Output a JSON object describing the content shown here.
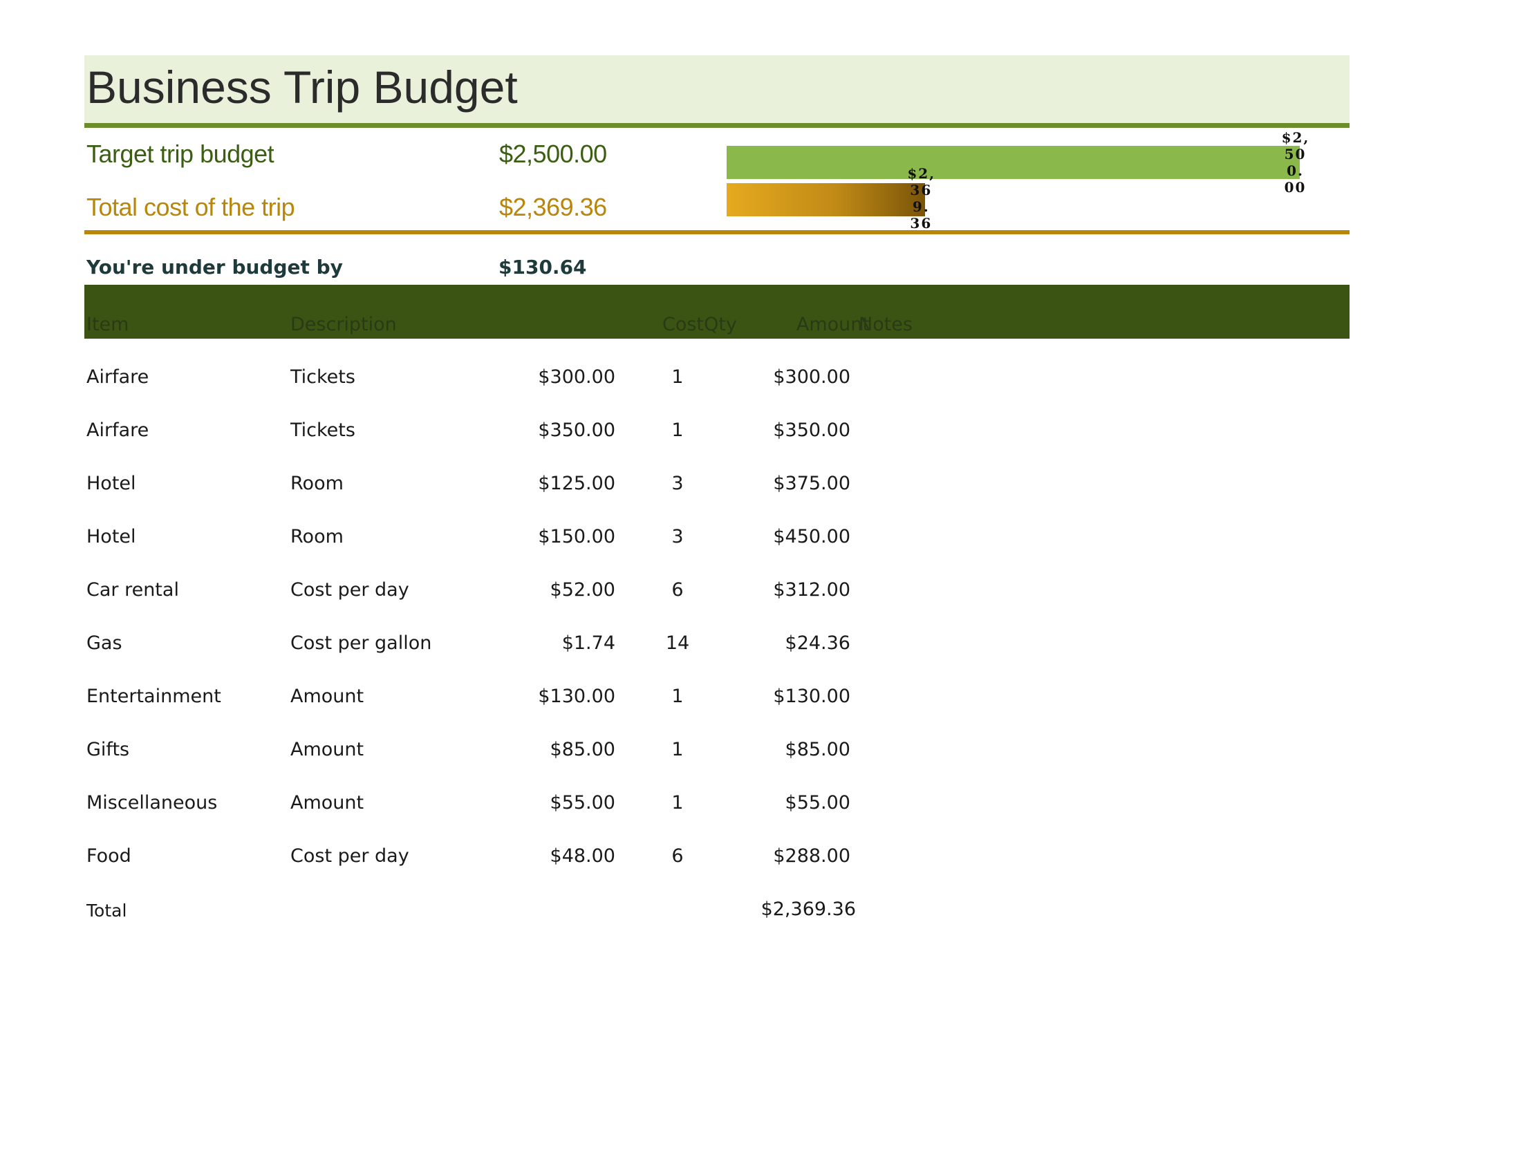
{
  "title": "Business Trip Budget",
  "summary": {
    "target_label": "Target trip budget",
    "target_value": "$2,500.00",
    "total_label": "Total cost of the trip",
    "total_value": "$2,369.36",
    "under_label": "You're under budget by",
    "under_value": "$130.64"
  },
  "chart_data": {
    "type": "bar",
    "orientation": "horizontal",
    "categories": [
      "Target trip budget",
      "Total cost of the trip"
    ],
    "values": [
      2500.0,
      2369.36
    ],
    "labels": [
      "$2,500.00",
      "$2,369.36"
    ],
    "xlim": [
      2300,
      2510
    ],
    "colors": [
      "#8bb84b",
      "#c08a16"
    ],
    "title": "",
    "xlabel": "",
    "ylabel": ""
  },
  "table": {
    "headers": {
      "item": "Item",
      "description": "Description",
      "cost": "Cost",
      "qty": "Qty",
      "amount": "Amount",
      "notes": "Notes"
    },
    "rows": [
      {
        "item": "Airfare",
        "description": "Tickets",
        "cost": "$300.00",
        "qty": "1",
        "amount": "$300.00"
      },
      {
        "item": "Airfare",
        "description": "Tickets",
        "cost": "$350.00",
        "qty": "1",
        "amount": "$350.00"
      },
      {
        "item": "Hotel",
        "description": "Room",
        "cost": "$125.00",
        "qty": "3",
        "amount": "$375.00"
      },
      {
        "item": "Hotel",
        "description": "Room",
        "cost": "$150.00",
        "qty": "3",
        "amount": "$450.00"
      },
      {
        "item": "Car rental",
        "description": "Cost per day",
        "cost": "$52.00",
        "qty": "6",
        "amount": "$312.00"
      },
      {
        "item": "Gas",
        "description": "Cost per gallon",
        "cost": "$1.74",
        "qty": "14",
        "amount": "$24.36"
      },
      {
        "item": "Entertainment",
        "description": "Amount",
        "cost": "$130.00",
        "qty": "1",
        "amount": "$130.00"
      },
      {
        "item": "Gifts",
        "description": "Amount",
        "cost": "$85.00",
        "qty": "1",
        "amount": "$85.00"
      },
      {
        "item": "Miscellaneous",
        "description": "Amount",
        "cost": "$55.00",
        "qty": "1",
        "amount": "$55.00"
      },
      {
        "item": "Food",
        "description": "Cost per day",
        "cost": "$48.00",
        "qty": "6",
        "amount": "$288.00"
      }
    ],
    "total_label": "Total",
    "total_value": "$2,369.36"
  }
}
